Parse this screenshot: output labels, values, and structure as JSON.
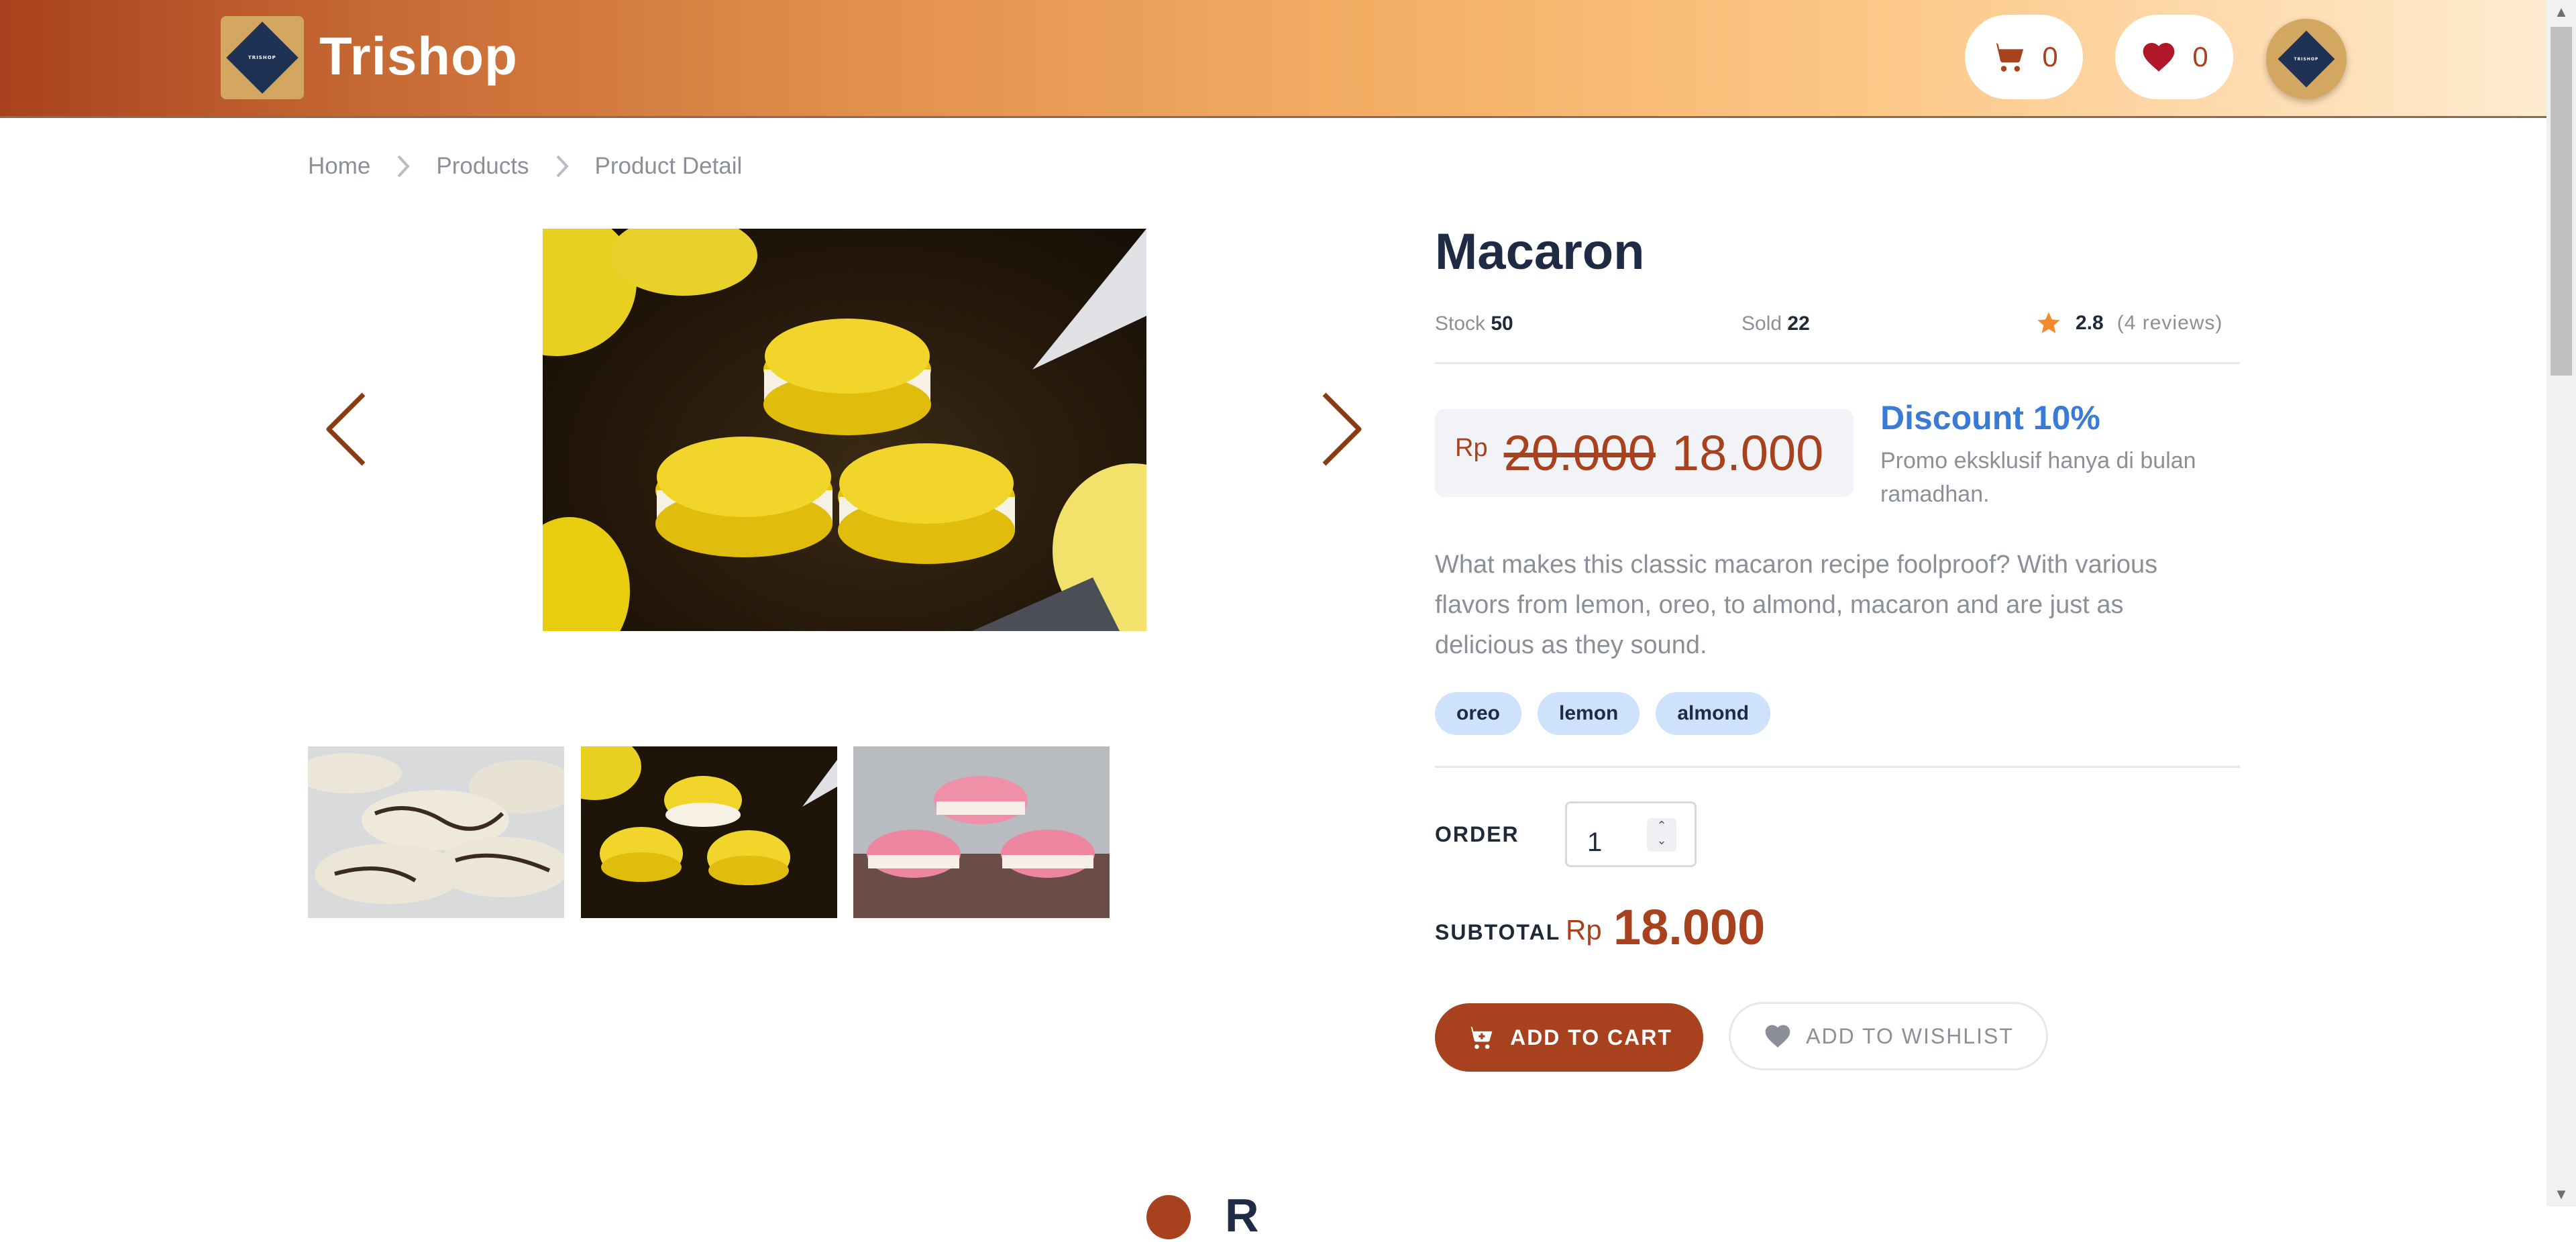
{
  "header": {
    "logo_text": "TRISHOP",
    "brand": "Trishop",
    "cart_count": "0",
    "wishlist_count": "0",
    "avatar_text": "TRISHOP"
  },
  "breadcrumb": [
    "Home",
    "Products",
    "Product Detail"
  ],
  "product": {
    "name": "Macaron",
    "stock_label": "Stock",
    "stock_value": "50",
    "sold_label": "Sold",
    "sold_value": "22",
    "rating": "2.8",
    "reviews": "(4 reviews)",
    "currency": "Rp",
    "old_price": "20.000",
    "new_price": "18.000",
    "discount_title": "Discount 10%",
    "discount_desc": "Promo eksklusif hanya di bulan ramadhan.",
    "description": "What makes this classic macaron recipe foolproof? With various flavors from lemon, oreo, to almond, macaron and are just as delicious as they sound.",
    "tags": [
      "oreo",
      "lemon",
      "almond"
    ]
  },
  "order": {
    "order_label": "ORDER",
    "quantity": "1",
    "subtotal_label": "SUBTOTAL",
    "subtotal_currency": "Rp",
    "subtotal_value": "18.000"
  },
  "actions": {
    "add_to_cart": "ADD TO CART",
    "add_to_wishlist": "ADD TO WISHLIST"
  },
  "next_section_heading": "R",
  "colors": {
    "brand": "#a8421e",
    "accent_blue": "#3a7bd5",
    "tag_bg": "#cfe2fb",
    "star": "#f08a2c",
    "logo_bg": "#d3a760",
    "logo_diamond": "#1f3254"
  }
}
